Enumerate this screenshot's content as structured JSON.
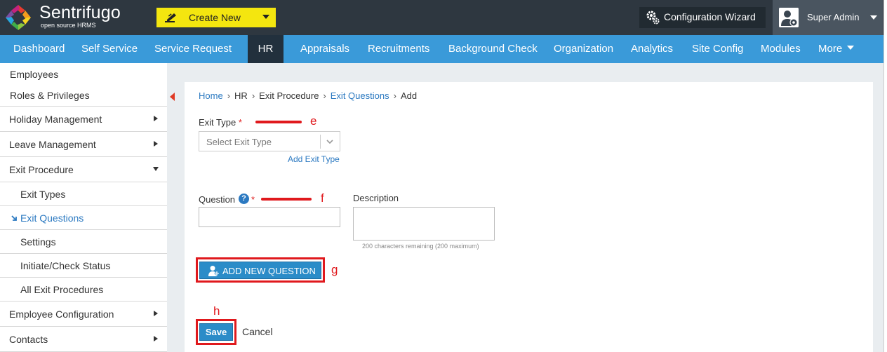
{
  "header": {
    "brand": "Sentrifugo",
    "brand_sub": "open source HRMS",
    "create_new_label": "Create New",
    "wizard_label": "Configuration Wizard",
    "user_label": "Super Admin",
    "icons": [
      "sentrifugo-logo-icon",
      "pen-icon",
      "gears-icon",
      "user-gear-icon",
      "chevron-down-icon"
    ],
    "colors": {
      "topbar": "#2e3740",
      "create_new": "#f4e60f",
      "navbar": "#3a9ad9",
      "nav_active": "#22303d",
      "link": "#2b79c1",
      "annotation": "#e0191d"
    }
  },
  "nav": {
    "items": [
      {
        "label": "Dashboard"
      },
      {
        "label": "Self Service"
      },
      {
        "label": "Service Request"
      },
      {
        "label": "HR",
        "active": true
      },
      {
        "label": "Appraisals"
      },
      {
        "label": "Recruitments"
      },
      {
        "label": "Background Check"
      },
      {
        "label": "Organization"
      },
      {
        "label": "Analytics"
      },
      {
        "label": "Site Config"
      },
      {
        "label": "Modules"
      },
      {
        "label": "More"
      }
    ]
  },
  "sidebar": {
    "items": [
      {
        "label": "Employees"
      },
      {
        "label": "Roles & Privileges"
      },
      {
        "label": "Holiday Management"
      },
      {
        "label": "Leave Management"
      },
      {
        "label": "Exit Procedure",
        "expanded": true
      },
      {
        "label": "Exit Types"
      },
      {
        "label": "Exit Questions",
        "current": true
      },
      {
        "label": "Settings"
      },
      {
        "label": "Initiate/Check Status"
      },
      {
        "label": "All Exit Procedures"
      },
      {
        "label": "Employee Configuration"
      },
      {
        "label": "Contacts"
      }
    ]
  },
  "breadcrumb": {
    "items": [
      "Home",
      "HR",
      "Exit Procedure",
      "Exit Questions",
      "Add"
    ]
  },
  "form": {
    "exit_type_label": "Exit Type",
    "required_mark": "*",
    "exit_type_placeholder": "Select Exit Type",
    "add_exit_type_link": "Add Exit Type",
    "question_label": "Question",
    "help_mark": "?",
    "question_value": "",
    "description_label": "Description",
    "description_value": "",
    "chars_remaining": "200 characters remaining (200 maximum)",
    "add_question_button": "ADD NEW QUESTION",
    "save_button": "Save",
    "cancel_link": "Cancel"
  },
  "annotations": {
    "e": "e",
    "f": "f",
    "g": "g",
    "h": "h"
  }
}
